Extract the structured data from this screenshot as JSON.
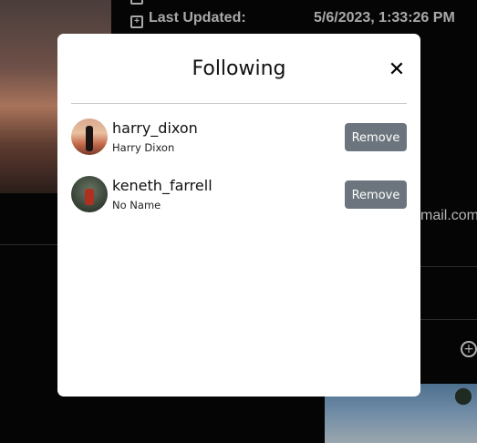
{
  "background": {
    "last_updated_label": "Last Updated:",
    "last_updated_value": "5/6/2023, 1:33:26 PM",
    "email_fragment": "mail.com",
    "plus_symbol": "+",
    "calendar_glyph": "+"
  },
  "modal": {
    "title": "Following",
    "close_symbol": "✕",
    "remove_label": "Remove",
    "users": [
      {
        "username": "harry_dixon",
        "name": "Harry Dixon"
      },
      {
        "username": "keneth_farrell",
        "name": "No Name"
      }
    ]
  }
}
